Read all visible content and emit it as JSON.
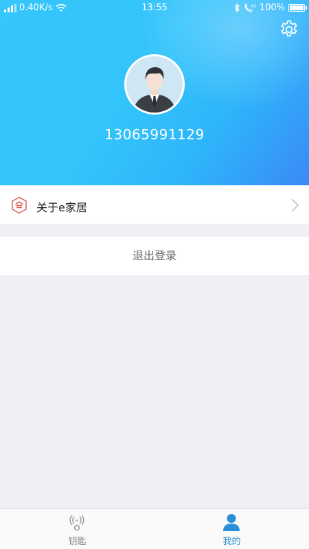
{
  "status_bar": {
    "network_speed": "0.40K/s",
    "time": "13:55",
    "battery": "100%",
    "battery_level": 1.0
  },
  "header": {
    "phone_number": "13065991129",
    "settings_icon": "gear-icon",
    "avatar_icon": "user-avatar-businessman"
  },
  "menu": {
    "about_label": "关于e家居",
    "about_icon": "shield-house-icon",
    "logout_label": "退出登录"
  },
  "tab_bar": {
    "tabs": [
      {
        "label": "钥匙",
        "icon": "key-wireless-icon",
        "active": false
      },
      {
        "label": "我的",
        "icon": "person-icon",
        "active": true
      }
    ]
  },
  "colors": {
    "header_blue": "#35c6fb",
    "active_tab": "#2a8fd9",
    "about_icon_red": "#d9534f"
  }
}
